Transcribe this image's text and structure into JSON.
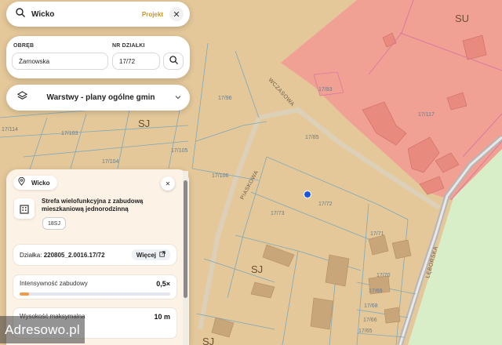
{
  "search": {
    "value": "Wicko",
    "badge": "Projekt",
    "close": "✕"
  },
  "parcel_form": {
    "obreb_label": "OBRĘB",
    "dzialka_label": "NR DZIAŁKI",
    "obreb_value": "Żarnowska",
    "dzialka_value": "17/72"
  },
  "layers": {
    "label": "Warstwy - plany ogólne gmin"
  },
  "map": {
    "zone_labels": [
      "SU",
      "SJ",
      "SJ",
      "SJ"
    ],
    "road_labels": [
      "WCZASOWA",
      "PIASKOWA",
      "LĘBORSKA"
    ],
    "parcel_labels": [
      "17/114",
      "17/103",
      "17/104",
      "17/105",
      "17/106",
      "17/96",
      "17/83",
      "17/117",
      "17/85",
      "17/73",
      "17/72",
      "17/71",
      "17/70",
      "17/69",
      "17/68",
      "17/66",
      "17/65"
    ],
    "colors": {
      "background": "#e4c89a",
      "su_zone": "#f1a194",
      "green": "#d8eec9",
      "road": "#bdbdbd",
      "lines": "#7fa8b8"
    }
  },
  "panel": {
    "location": "Wicko",
    "zone_title": "Strefa wielofunkcyjna z zabudową mieszkaniową jednorodzinną",
    "zone_code": "18SJ",
    "dzialka_prefix": "Działka:",
    "dzialka_id": "220805_2.0016.17/72",
    "more_label": "Więcej",
    "metrics": [
      {
        "label": "Intensywność zabudowy",
        "value": "0,5×",
        "fraction": 0.06
      },
      {
        "label": "Wysokość maksymalna",
        "value": "10 m"
      }
    ]
  },
  "watermark": "Adresowo.pl",
  "accent_orange": "#f09a4a",
  "marker_color": "#1a55e0",
  "icons": [
    "search-icon",
    "close-icon",
    "layers-icon",
    "chevron-down-icon",
    "pin-icon",
    "building-icon",
    "external-link-icon"
  ]
}
